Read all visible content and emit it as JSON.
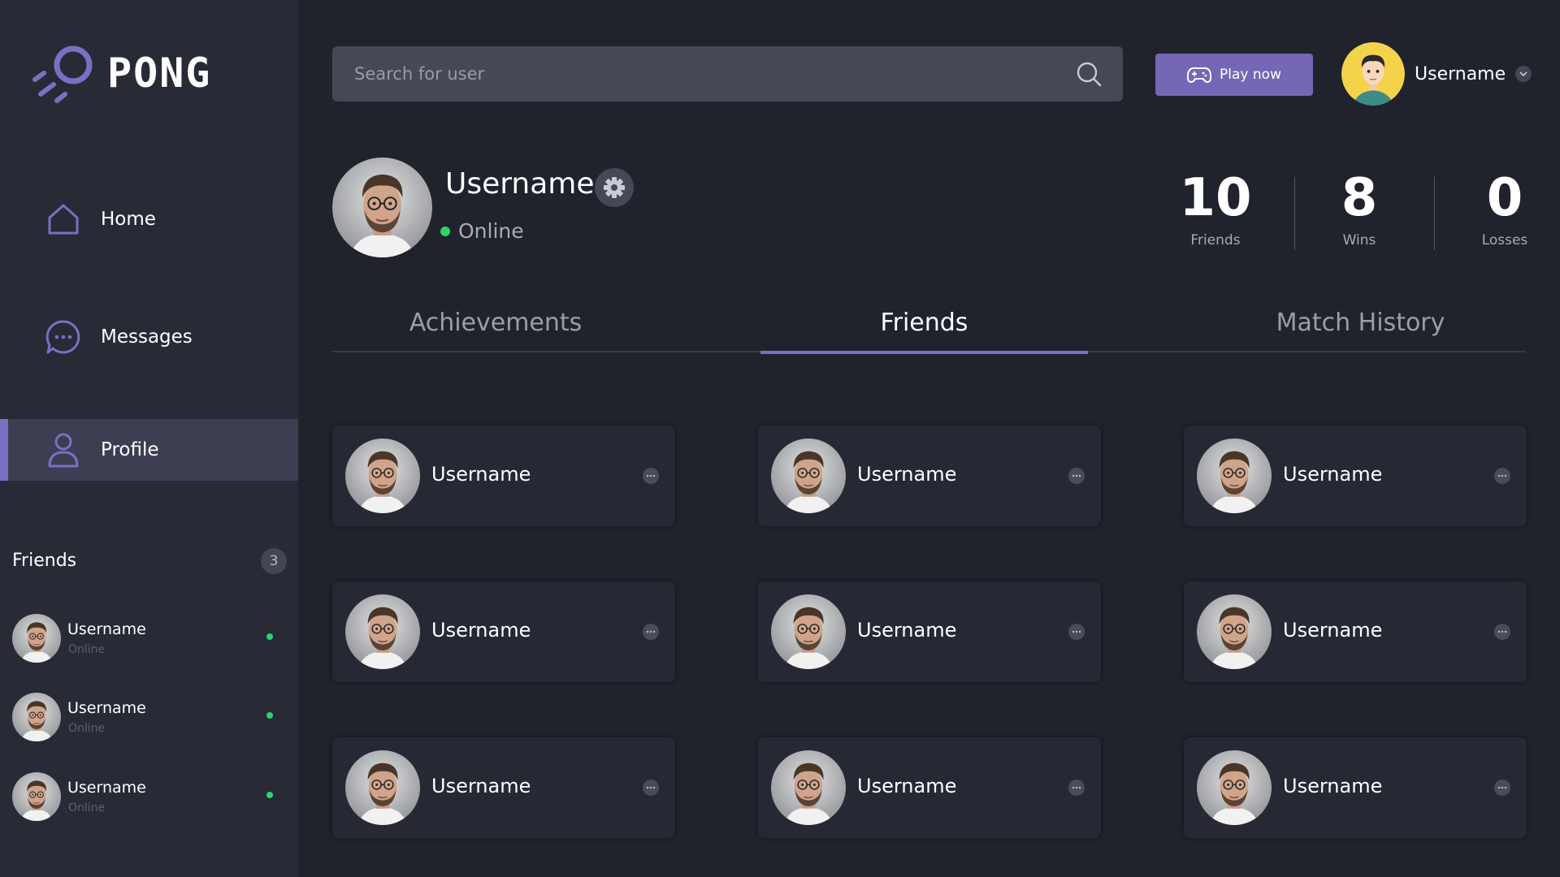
{
  "app": {
    "logo_text": "PONG"
  },
  "sidebar": {
    "nav": [
      {
        "label": "Home",
        "icon": "home-icon"
      },
      {
        "label": "Messages",
        "icon": "chat-bubble-icon"
      },
      {
        "label": "Profile",
        "icon": "user-icon",
        "active": true
      }
    ],
    "friends_heading": "Friends",
    "friends_count": "3",
    "friends": [
      {
        "name": "Username",
        "status": "Online"
      },
      {
        "name": "Username",
        "status": "Online"
      },
      {
        "name": "Username",
        "status": "Online"
      }
    ]
  },
  "header": {
    "search_placeholder": "Search for user",
    "play_label": "Play now",
    "user_name": "Username"
  },
  "profile": {
    "name": "Username",
    "status": "Online",
    "stats": [
      {
        "value": "10",
        "label": "Friends"
      },
      {
        "value": "8",
        "label": "Wins"
      },
      {
        "value": "0",
        "label": "Losses"
      }
    ]
  },
  "tabs": [
    {
      "label": "Achievements"
    },
    {
      "label": "Friends",
      "active": true
    },
    {
      "label": "Match History"
    }
  ],
  "friend_cards": [
    {
      "name": "Username"
    },
    {
      "name": "Username"
    },
    {
      "name": "Username"
    },
    {
      "name": "Username"
    },
    {
      "name": "Username"
    },
    {
      "name": "Username"
    },
    {
      "name": "Username"
    },
    {
      "name": "Username"
    },
    {
      "name": "Username"
    }
  ],
  "colors": {
    "accent": "#7b6fc4",
    "play_button": "#7567b5",
    "online": "#2ed36b",
    "background": "#20222c",
    "sidebar": "#282a36"
  }
}
